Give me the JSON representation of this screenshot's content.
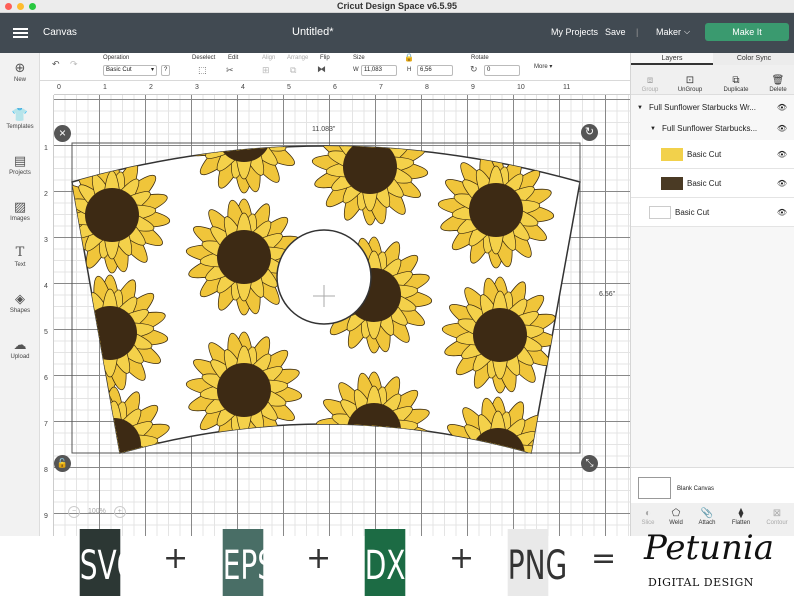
{
  "window": {
    "title": "Cricut Design Space  v6.5.95"
  },
  "nav": {
    "page": "Canvas",
    "project": "Untitled*",
    "my_projects": "My Projects",
    "save": "Save",
    "divider": "|",
    "machine": "Maker",
    "make_it": "Make It"
  },
  "toolbar": {
    "operation_label": "Operation",
    "operation_value": "Basic Cut",
    "help": "?",
    "deselect": "Deselect",
    "edit": "Edit",
    "align": "Align",
    "arrange": "Arrange",
    "flip": "Flip",
    "size": "Size",
    "w_label": "W",
    "w_value": "11,083",
    "h_label": "H",
    "h_value": "6,56",
    "rotate": "Rotate",
    "rotate_value": "0",
    "more": "More"
  },
  "left": {
    "new": "New",
    "templates": "Templates",
    "projects": "Projects",
    "images": "Images",
    "text": "Text",
    "shapes": "Shapes",
    "upload": "Upload"
  },
  "ruler": {
    "h": [
      "0",
      "1",
      "2",
      "3",
      "4",
      "5",
      "6",
      "7",
      "8",
      "9",
      "10",
      "11"
    ],
    "v": [
      "1",
      "2",
      "3",
      "4",
      "5",
      "6",
      "7",
      "8",
      "9"
    ]
  },
  "canvas": {
    "width_dim": "11.083\"",
    "height_dim": "6.56\"",
    "zoom": "100%",
    "zoom_minus": "−",
    "zoom_plus": "+"
  },
  "panel": {
    "tabs": [
      "Layers",
      "Color Sync"
    ],
    "actions": [
      "Group",
      "UnGroup",
      "Duplicate",
      "Delete"
    ],
    "layers": [
      "Full Sunflower Starbucks Wr...",
      "Full Sunflower Starbucks...",
      "Basic Cut",
      "Basic Cut",
      "Basic Cut"
    ],
    "blank_canvas": "Blank Canvas",
    "bottom_actions": [
      "Slice",
      "Weld",
      "Attach",
      "Flatten",
      "Contour"
    ]
  },
  "banner": {
    "items": [
      "SVG",
      "EPS",
      "DXF",
      "PNG"
    ],
    "plus": "+",
    "equals": "=",
    "brand": "Petunia",
    "brand_sub": "DIGITAL DESIGN",
    "colors": [
      "#2c3734",
      "#496e66",
      "#1c6b44",
      "#e9e9e9"
    ]
  }
}
